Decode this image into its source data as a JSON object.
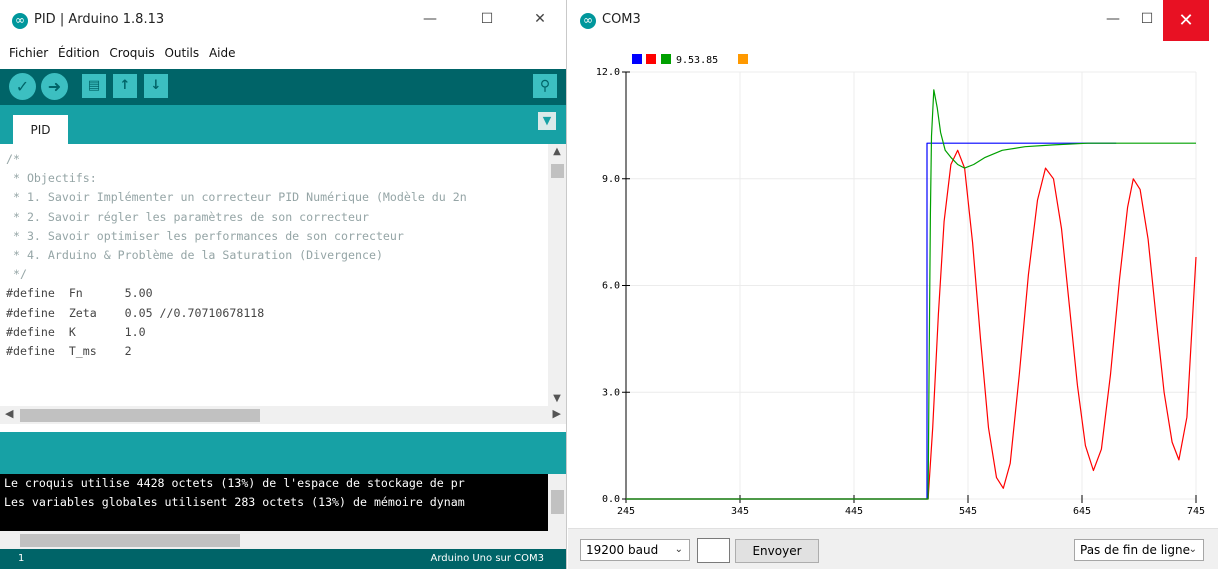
{
  "ide": {
    "title": "PID | Arduino 1.8.13",
    "menu": [
      "Fichier",
      "Édition",
      "Croquis",
      "Outils",
      "Aide"
    ],
    "tab": "PID",
    "code": [
      "",
      "/*",
      " * Objectifs:",
      " * 1. Savoir Implémenter un correcteur PID Numérique (Modèle du 2n",
      " * 2. Savoir régler les paramètres de son correcteur",
      " * 3. Savoir optimiser les performances de son correcteur",
      " * 4. Arduino & Problème de la Saturation (Divergence)",
      " */",
      "",
      "#define  Fn      5.00",
      "#define  Zeta    0.05 //0.70710678118",
      "#define  K       1.0",
      "#define  T_ms    2"
    ],
    "console": [
      "Le croquis utilise 4428 octets (13%) de l'espace de stockage de pr",
      "Les variables globales utilisent 283 octets (13%) de mémoire dynam"
    ],
    "status_line": "1",
    "status_board": "Arduino Uno sur COM3"
  },
  "plotter": {
    "title": "COM3",
    "legend_value": "9.53.85",
    "legend_colors": [
      "#0000ff",
      "#ff0000",
      "#00a000",
      "#ff9900"
    ],
    "baud": "19200 baud",
    "send_label": "Envoyer",
    "line_ending": "Pas de fin de ligne",
    "input_value": ""
  },
  "chart_data": {
    "type": "line",
    "title": "",
    "xlabel": "",
    "ylabel": "",
    "xlim": [
      245,
      745
    ],
    "ylim": [
      0,
      12
    ],
    "x_ticks": [
      "245",
      "345",
      "445",
      "545",
      "645",
      "745"
    ],
    "y_ticks": [
      "0.0",
      "3.0",
      "6.0",
      "9.0",
      "12.0"
    ],
    "grid": true,
    "series": [
      {
        "color": "#0000ff",
        "points": [
          [
            245,
            0
          ],
          [
            509,
            0
          ],
          [
            509,
            10
          ],
          [
            675,
            10
          ]
        ]
      },
      {
        "color": "#ff0000",
        "points": [
          [
            245,
            0
          ],
          [
            510,
            0
          ],
          [
            514,
            2.0
          ],
          [
            519,
            5.2
          ],
          [
            524,
            7.8
          ],
          [
            530,
            9.4
          ],
          [
            536,
            9.8
          ],
          [
            542,
            9.3
          ],
          [
            549,
            7.2
          ],
          [
            556,
            4.5
          ],
          [
            563,
            2.0
          ],
          [
            570,
            0.6
          ],
          [
            576,
            0.3
          ],
          [
            582,
            1.0
          ],
          [
            590,
            3.5
          ],
          [
            598,
            6.3
          ],
          [
            606,
            8.4
          ],
          [
            613,
            9.3
          ],
          [
            620,
            9.0
          ],
          [
            627,
            7.6
          ],
          [
            634,
            5.4
          ],
          [
            641,
            3.2
          ],
          [
            648,
            1.5
          ],
          [
            655,
            0.8
          ],
          [
            662,
            1.4
          ],
          [
            670,
            3.5
          ],
          [
            678,
            6.2
          ],
          [
            685,
            8.2
          ],
          [
            690,
            9.0
          ],
          [
            696,
            8.7
          ],
          [
            703,
            7.3
          ],
          [
            710,
            5.1
          ],
          [
            717,
            3.0
          ],
          [
            724,
            1.6
          ],
          [
            730,
            1.1
          ],
          [
            737,
            2.3
          ],
          [
            745,
            6.8
          ]
        ]
      },
      {
        "color": "#00a000",
        "points": [
          [
            245,
            0
          ],
          [
            510,
            0
          ],
          [
            511,
            4.0
          ],
          [
            512,
            8.0
          ],
          [
            513,
            10.2
          ],
          [
            515,
            11.5
          ],
          [
            518,
            11.0
          ],
          [
            521,
            10.3
          ],
          [
            525,
            9.8
          ],
          [
            530,
            9.6
          ],
          [
            536,
            9.4
          ],
          [
            542,
            9.3
          ],
          [
            550,
            9.4
          ],
          [
            560,
            9.6
          ],
          [
            575,
            9.8
          ],
          [
            595,
            9.9
          ],
          [
            620,
            9.95
          ],
          [
            650,
            10.0
          ],
          [
            745,
            10.0
          ]
        ]
      }
    ]
  }
}
